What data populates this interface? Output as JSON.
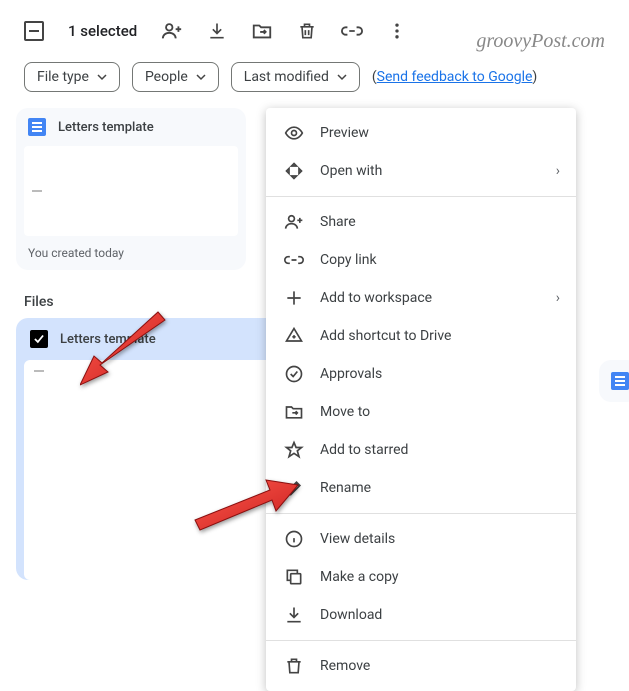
{
  "toolbar": {
    "selection": "1 selected"
  },
  "watermark": "groovyPost.com",
  "filters": {
    "file_type": "File type",
    "people": "People",
    "last_modified": "Last modified"
  },
  "feedback": "Send feedback to Google",
  "suggested_card": {
    "title": "Letters template",
    "footer": "You created today"
  },
  "section": {
    "files": "Files"
  },
  "selected_file": {
    "title": "Letters template"
  },
  "menu": {
    "preview": "Preview",
    "open_with": "Open with",
    "share": "Share",
    "copy_link": "Copy link",
    "add_to_workspace": "Add to workspace",
    "add_shortcut": "Add shortcut to Drive",
    "approvals": "Approvals",
    "move_to": "Move to",
    "add_to_starred": "Add to starred",
    "rename": "Rename",
    "view_details": "View details",
    "make_a_copy": "Make a copy",
    "download": "Download",
    "remove": "Remove"
  }
}
